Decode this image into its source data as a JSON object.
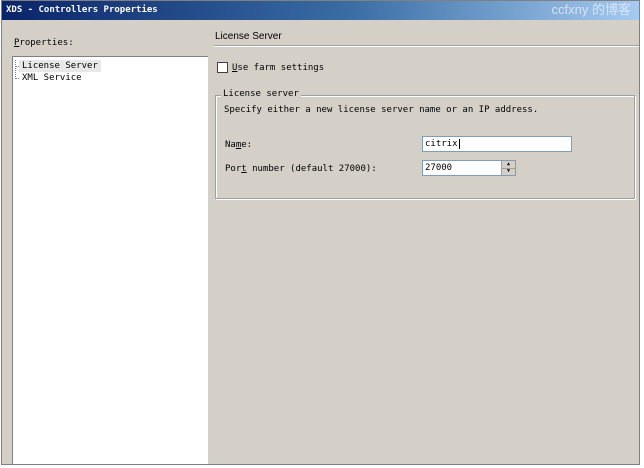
{
  "window": {
    "title": "XDS - Controllers Properties",
    "watermark": "ccfxny 的博客"
  },
  "left_pane": {
    "properties_label_underlined": "P",
    "properties_label_rest": "roperties:",
    "tree_items": [
      {
        "label": "License Server",
        "selected": true
      },
      {
        "label": "XML Service",
        "selected": false
      }
    ]
  },
  "right_pane": {
    "heading": "License Server",
    "use_farm_settings": {
      "label_underlined": "U",
      "label_rest": "se farm settings",
      "checked": false
    },
    "group": {
      "legend": "License server",
      "description": "Specify either a new license server name or an IP address.",
      "name_label_pre": "Na",
      "name_label_underlined": "m",
      "name_label_post": "e:",
      "name_value": "citrix",
      "port_label_pre": "Por",
      "port_label_underlined": "t",
      "port_label_post": " number (default 27000):",
      "port_value": "27000"
    }
  },
  "colors": {
    "titlebar_start": "#0a246a",
    "titlebar_end": "#a6caf0",
    "dialog_bg": "#d4d0c8"
  }
}
